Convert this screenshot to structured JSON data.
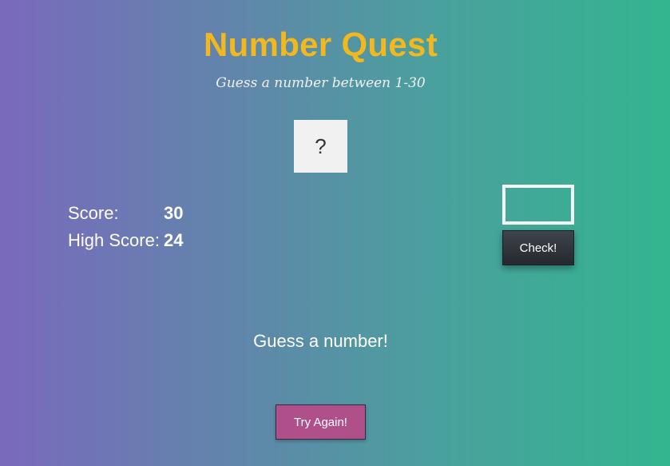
{
  "app": {
    "title": "Number Quest",
    "subtitle": "Guess a number between 1-30"
  },
  "secret_number": {
    "display": "?"
  },
  "scores": {
    "score_label": "Score:",
    "score_value": "30",
    "high_score_label": "High Score:",
    "high_score_value": "24"
  },
  "guess": {
    "input_value": "",
    "check_label": "Check!"
  },
  "message": "Guess a number!",
  "try_again_label": "Try Again!",
  "colors": {
    "title": "#f4b81f",
    "gradient_left": "#7a69bd",
    "gradient_right": "#33b58f",
    "number_box": "#f1f1f1",
    "check_button": "#2c3035",
    "try_again_button": "#b0508a"
  }
}
